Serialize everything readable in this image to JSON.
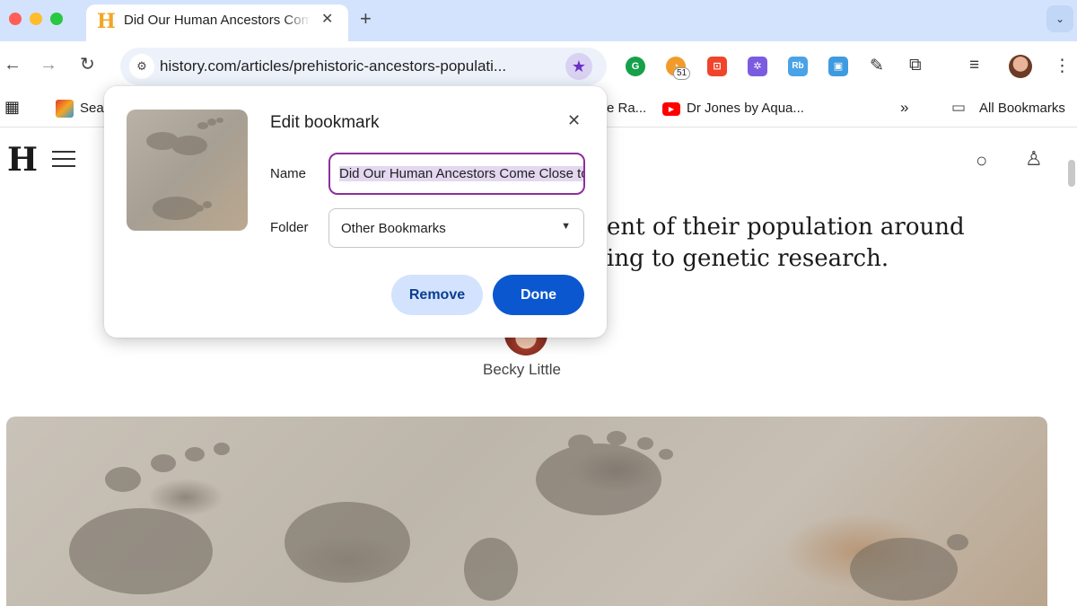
{
  "browser": {
    "tab": {
      "title": "Did Our Human Ancestors Come Close to Extinction?",
      "favicon": "H"
    },
    "new_tab_icon": "+",
    "tab_menu_icon": "chevron-down-icon",
    "url": "history.com/articles/prehistoric-ancestors-populati...",
    "extensions": [
      {
        "name": "grammarly-icon",
        "color": "#15a04a",
        "glyph": "G"
      },
      {
        "name": "counter-extension-icon",
        "color": "#f29b2b",
        "glyph": "◔",
        "badge": "51"
      },
      {
        "name": "lock-extension-icon",
        "color": "#f0442d",
        "glyph": "🔒"
      },
      {
        "name": "purple-extension-icon",
        "color": "#7b5ce0",
        "glyph": "✲"
      },
      {
        "name": "rb-extension-icon",
        "color": "#49a3e6",
        "glyph": "Rb"
      },
      {
        "name": "image-extension-icon",
        "color": "#3f9be0",
        "glyph": "▣"
      }
    ]
  },
  "bookmarks_bar": {
    "items": [
      "Sea",
      "e Ra...",
      "Dr Jones by Aqua..."
    ],
    "overflow": "»",
    "all_bookmarks": "All Bookmarks"
  },
  "page": {
    "logo": "H",
    "subtitle_line1": "ent of their population around",
    "subtitle_line2": "ing to genetic research.",
    "author": "Becky Little"
  },
  "dialog": {
    "title": "Edit bookmark",
    "name_label": "Name",
    "name_value": "Did Our Human Ancestors Come Close to Extinction?",
    "folder_label": "Folder",
    "folder_value": "Other Bookmarks",
    "remove_label": "Remove",
    "done_label": "Done"
  },
  "colors": {
    "tabstrip": "#d3e3fd",
    "accent_purple": "#8d2e9e",
    "done_blue": "#0b57d0",
    "remove_bg": "#d3e3fd"
  }
}
